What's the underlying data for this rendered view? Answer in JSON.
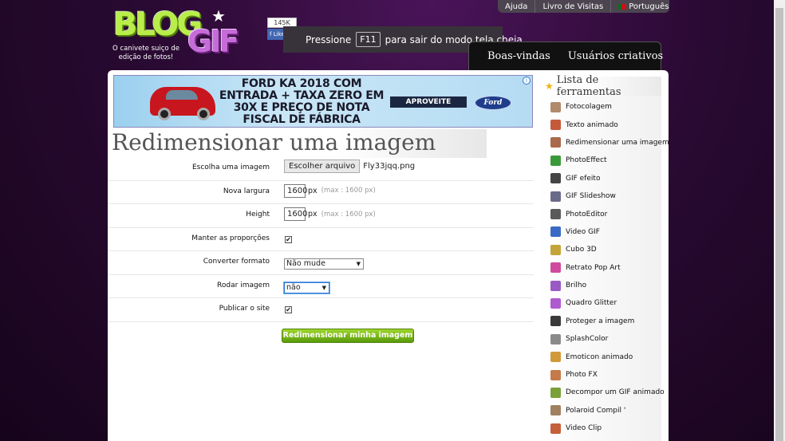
{
  "brand": {
    "logo_word1": "BLOG",
    "logo_word2": "GIF",
    "tagline": "O canivete suiço de edição de fotos!"
  },
  "facebook": {
    "count": "145K",
    "like_label": "Like"
  },
  "topnav": {
    "help": "Ajuda",
    "guestbook": "Livro de Visitas",
    "language": "Português"
  },
  "fullscreen_toast": {
    "prefix": "Pressione",
    "key": "F11",
    "suffix": "para sair do modo tela cheia"
  },
  "mainnav": {
    "welcome": "Boas-vindas",
    "creative_users": "Usuários criativos"
  },
  "ad": {
    "headline": "FORD KA 2018 COM ENTRADA + TAXA ZERO EM 30X E PREÇO DE NOTA FISCAL DE FÁBRICA",
    "button": "APROVEITE",
    "brand": "Ford",
    "info_icon": "i"
  },
  "page_title": "Redimensionar uma imagem",
  "form": {
    "file_label": "Escolha uma imagem",
    "file_button": "Escolher arquivo",
    "file_name": "Fly33jqq.png",
    "width_label": "Nova largura",
    "width_value": "1600",
    "width_unit": "px",
    "width_hint": "(max : 1600 px)",
    "height_label": "Height",
    "height_value": "1600",
    "height_unit": "px",
    "height_hint": "(max : 1600 px)",
    "keep_ratio_label": "Manter as proporções",
    "keep_ratio_checked": true,
    "format_label": "Converter formato",
    "format_value": "Não mude",
    "rotate_label": "Rodar imagem",
    "rotate_value": "não",
    "publish_label": "Publicar o site",
    "publish_checked": true,
    "submit_label": "Redimensionar minha imagem"
  },
  "sidebar": {
    "title": "Lista de ferramentas",
    "tools": [
      {
        "label": "Fotocolagem",
        "color": "#b08a6a"
      },
      {
        "label": "Texto animado",
        "color": "#c45a3a"
      },
      {
        "label": "Redimensionar uma imagem",
        "color": "#a86a4a"
      },
      {
        "label": "PhotoEffect",
        "color": "#3a9a3a"
      },
      {
        "label": "GIF efeito",
        "color": "#444444"
      },
      {
        "label": "GIF Slideshow",
        "color": "#6a6a8a"
      },
      {
        "label": "PhotoEditor",
        "color": "#5a5a5a"
      },
      {
        "label": "Video GIF",
        "color": "#3a6ac4"
      },
      {
        "label": "Cubo 3D",
        "color": "#c4a43a"
      },
      {
        "label": "Retrato Pop Art",
        "color": "#d04aa0"
      },
      {
        "label": "Brilho",
        "color": "#9a5ac4"
      },
      {
        "label": "Quadro Glitter",
        "color": "#b05ad0"
      },
      {
        "label": "Proteger a imagem",
        "color": "#3a3a3a"
      },
      {
        "label": "SplashColor",
        "color": "#8a8a8a"
      },
      {
        "label": "Emoticon animado",
        "color": "#d09a3a"
      },
      {
        "label": "Photo FX",
        "color": "#c47a4a"
      },
      {
        "label": "Decompor um GIF animado",
        "color": "#7aa03a"
      },
      {
        "label": "Polaroid Compil '",
        "color": "#a08060"
      },
      {
        "label": "Video Clip",
        "color": "#c4603a"
      }
    ]
  }
}
